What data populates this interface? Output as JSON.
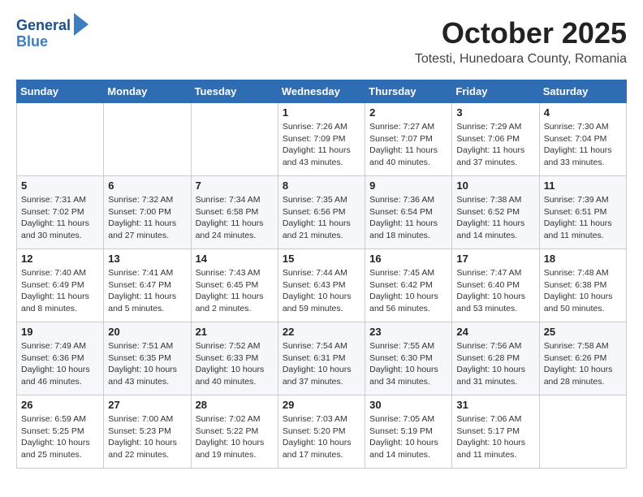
{
  "header": {
    "logo_line1": "General",
    "logo_line2": "Blue",
    "month": "October 2025",
    "location": "Totesti, Hunedoara County, Romania"
  },
  "weekdays": [
    "Sunday",
    "Monday",
    "Tuesday",
    "Wednesday",
    "Thursday",
    "Friday",
    "Saturday"
  ],
  "weeks": [
    [
      {
        "day": "",
        "info": ""
      },
      {
        "day": "",
        "info": ""
      },
      {
        "day": "",
        "info": ""
      },
      {
        "day": "1",
        "info": "Sunrise: 7:26 AM\nSunset: 7:09 PM\nDaylight: 11 hours and 43 minutes."
      },
      {
        "day": "2",
        "info": "Sunrise: 7:27 AM\nSunset: 7:07 PM\nDaylight: 11 hours and 40 minutes."
      },
      {
        "day": "3",
        "info": "Sunrise: 7:29 AM\nSunset: 7:06 PM\nDaylight: 11 hours and 37 minutes."
      },
      {
        "day": "4",
        "info": "Sunrise: 7:30 AM\nSunset: 7:04 PM\nDaylight: 11 hours and 33 minutes."
      }
    ],
    [
      {
        "day": "5",
        "info": "Sunrise: 7:31 AM\nSunset: 7:02 PM\nDaylight: 11 hours and 30 minutes."
      },
      {
        "day": "6",
        "info": "Sunrise: 7:32 AM\nSunset: 7:00 PM\nDaylight: 11 hours and 27 minutes."
      },
      {
        "day": "7",
        "info": "Sunrise: 7:34 AM\nSunset: 6:58 PM\nDaylight: 11 hours and 24 minutes."
      },
      {
        "day": "8",
        "info": "Sunrise: 7:35 AM\nSunset: 6:56 PM\nDaylight: 11 hours and 21 minutes."
      },
      {
        "day": "9",
        "info": "Sunrise: 7:36 AM\nSunset: 6:54 PM\nDaylight: 11 hours and 18 minutes."
      },
      {
        "day": "10",
        "info": "Sunrise: 7:38 AM\nSunset: 6:52 PM\nDaylight: 11 hours and 14 minutes."
      },
      {
        "day": "11",
        "info": "Sunrise: 7:39 AM\nSunset: 6:51 PM\nDaylight: 11 hours and 11 minutes."
      }
    ],
    [
      {
        "day": "12",
        "info": "Sunrise: 7:40 AM\nSunset: 6:49 PM\nDaylight: 11 hours and 8 minutes."
      },
      {
        "day": "13",
        "info": "Sunrise: 7:41 AM\nSunset: 6:47 PM\nDaylight: 11 hours and 5 minutes."
      },
      {
        "day": "14",
        "info": "Sunrise: 7:43 AM\nSunset: 6:45 PM\nDaylight: 11 hours and 2 minutes."
      },
      {
        "day": "15",
        "info": "Sunrise: 7:44 AM\nSunset: 6:43 PM\nDaylight: 10 hours and 59 minutes."
      },
      {
        "day": "16",
        "info": "Sunrise: 7:45 AM\nSunset: 6:42 PM\nDaylight: 10 hours and 56 minutes."
      },
      {
        "day": "17",
        "info": "Sunrise: 7:47 AM\nSunset: 6:40 PM\nDaylight: 10 hours and 53 minutes."
      },
      {
        "day": "18",
        "info": "Sunrise: 7:48 AM\nSunset: 6:38 PM\nDaylight: 10 hours and 50 minutes."
      }
    ],
    [
      {
        "day": "19",
        "info": "Sunrise: 7:49 AM\nSunset: 6:36 PM\nDaylight: 10 hours and 46 minutes."
      },
      {
        "day": "20",
        "info": "Sunrise: 7:51 AM\nSunset: 6:35 PM\nDaylight: 10 hours and 43 minutes."
      },
      {
        "day": "21",
        "info": "Sunrise: 7:52 AM\nSunset: 6:33 PM\nDaylight: 10 hours and 40 minutes."
      },
      {
        "day": "22",
        "info": "Sunrise: 7:54 AM\nSunset: 6:31 PM\nDaylight: 10 hours and 37 minutes."
      },
      {
        "day": "23",
        "info": "Sunrise: 7:55 AM\nSunset: 6:30 PM\nDaylight: 10 hours and 34 minutes."
      },
      {
        "day": "24",
        "info": "Sunrise: 7:56 AM\nSunset: 6:28 PM\nDaylight: 10 hours and 31 minutes."
      },
      {
        "day": "25",
        "info": "Sunrise: 7:58 AM\nSunset: 6:26 PM\nDaylight: 10 hours and 28 minutes."
      }
    ],
    [
      {
        "day": "26",
        "info": "Sunrise: 6:59 AM\nSunset: 5:25 PM\nDaylight: 10 hours and 25 minutes."
      },
      {
        "day": "27",
        "info": "Sunrise: 7:00 AM\nSunset: 5:23 PM\nDaylight: 10 hours and 22 minutes."
      },
      {
        "day": "28",
        "info": "Sunrise: 7:02 AM\nSunset: 5:22 PM\nDaylight: 10 hours and 19 minutes."
      },
      {
        "day": "29",
        "info": "Sunrise: 7:03 AM\nSunset: 5:20 PM\nDaylight: 10 hours and 17 minutes."
      },
      {
        "day": "30",
        "info": "Sunrise: 7:05 AM\nSunset: 5:19 PM\nDaylight: 10 hours and 14 minutes."
      },
      {
        "day": "31",
        "info": "Sunrise: 7:06 AM\nSunset: 5:17 PM\nDaylight: 10 hours and 11 minutes."
      },
      {
        "day": "",
        "info": ""
      }
    ]
  ]
}
